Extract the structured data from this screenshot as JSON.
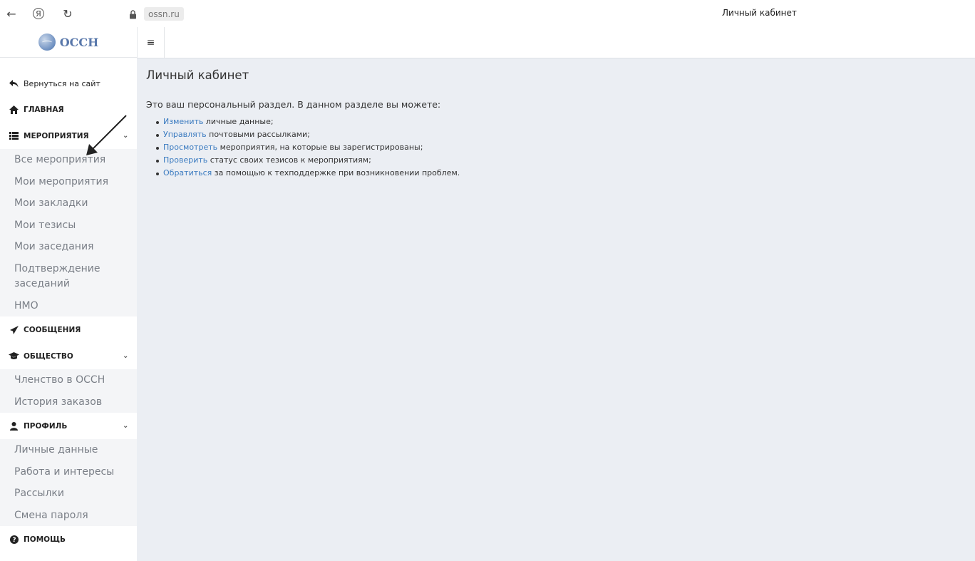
{
  "browser": {
    "back_icon": "←",
    "yandex_icon": "Я",
    "reload_icon": "↻",
    "lock_icon": "lock-icon",
    "domain": "ossn.ru",
    "tab_title": "Личный кабинет"
  },
  "logo": {
    "text": "ОССН"
  },
  "topbar": {
    "menu_icon": "≡"
  },
  "sidebar": {
    "back_label": "Вернуться на сайт",
    "home_label": "ГЛАВНАЯ",
    "events": {
      "label": "МЕРОПРИЯТИЯ",
      "items": [
        "Все мероприятия",
        "Мои мероприятия",
        "Мои закладки",
        "Мои тезисы",
        "Мои заседания",
        "Подтверждение заседаний",
        "НМО"
      ]
    },
    "messages_label": "СООБЩЕНИЯ",
    "society": {
      "label": "ОБЩЕСТВО",
      "items": [
        "Членство в ОССН",
        "История заказов"
      ]
    },
    "profile": {
      "label": "ПРОФИЛЬ",
      "items": [
        "Личные данные",
        "Работа и интересы",
        "Рассылки",
        "Смена пароля"
      ]
    },
    "help_label": "ПОМОЩЬ"
  },
  "main": {
    "title": "Личный кабинет",
    "intro": "Это ваш персональный раздел. В данном разделе вы можете:",
    "bullets": [
      {
        "link": "Изменить",
        "text": " личные данные;"
      },
      {
        "link": "Управлять",
        "text": " почтовыми рассылками;"
      },
      {
        "link": "Просмотреть",
        "text": " мероприятия, на которые вы зарегистрированы;"
      },
      {
        "link": "Проверить",
        "text": " статус своих тезисов к мероприятиям;"
      },
      {
        "link": "Обратиться",
        "text": " за помощью к техподдержке при возникновении проблем."
      }
    ]
  }
}
